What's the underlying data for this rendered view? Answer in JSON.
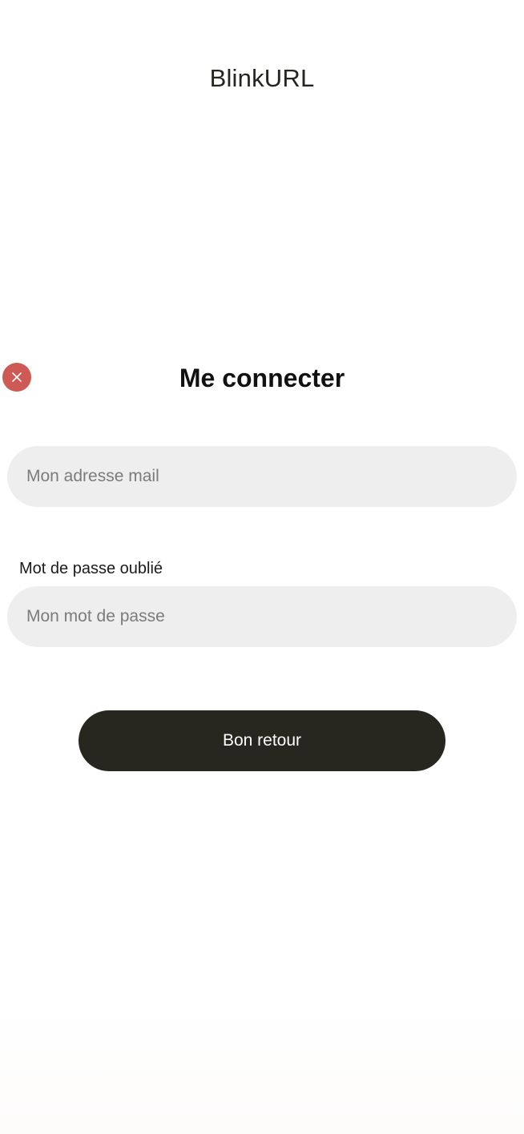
{
  "app": {
    "title": "BlinkURL"
  },
  "login": {
    "heading": "Me connecter",
    "close_icon": "close-icon",
    "email": {
      "value": "",
      "placeholder": "Mon adresse mail"
    },
    "forgot_password_label": "Mot de passe oublié",
    "password": {
      "value": "",
      "placeholder": "Mon mot de passe"
    },
    "submit_label": "Bon retour"
  },
  "colors": {
    "close_button": "#cd5a55",
    "primary_button": "#27261f",
    "input_background": "#eeeeee",
    "text": "#26251f"
  }
}
